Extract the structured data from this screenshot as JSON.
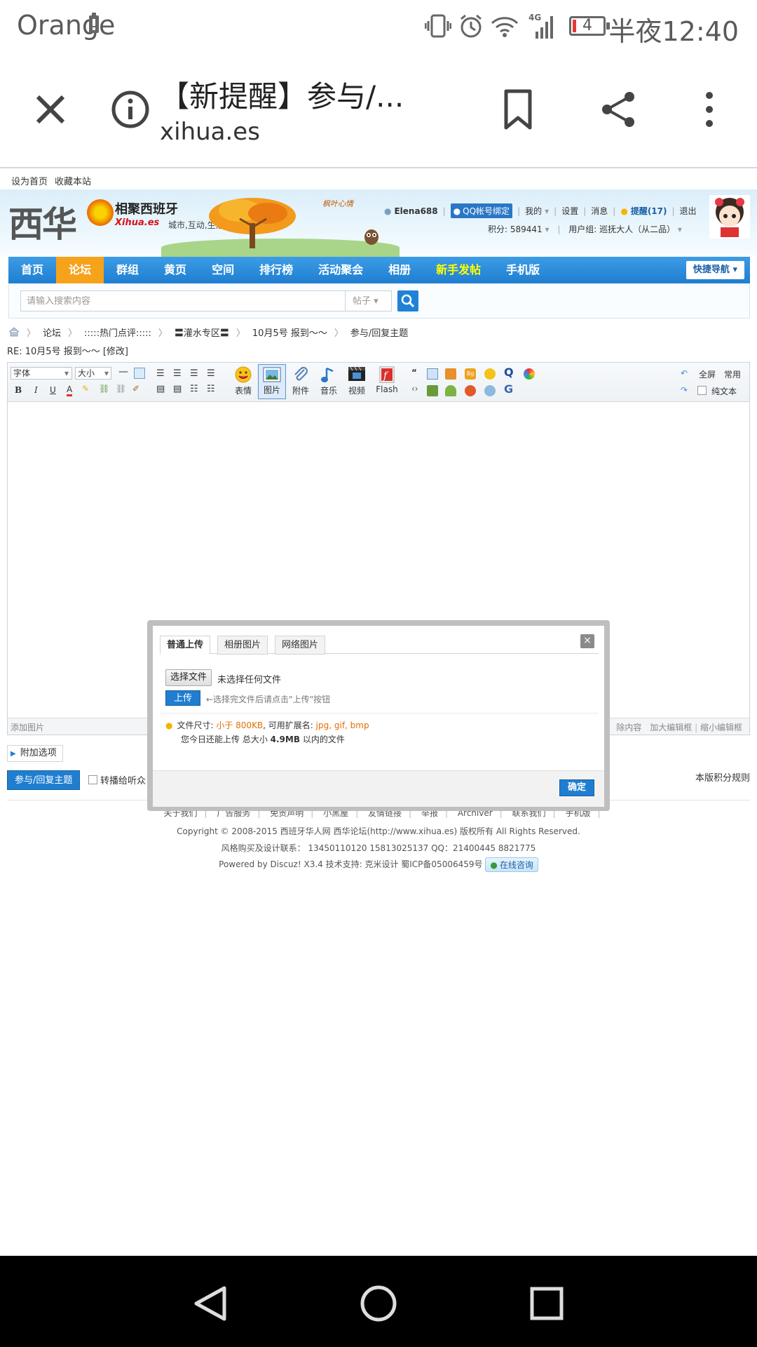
{
  "status_bar": {
    "carrier": "Orange",
    "battery_level": "4",
    "network": "4G",
    "time": "半夜12:40"
  },
  "browser": {
    "title": "【新提醒】参与/...",
    "url": "xihua.es"
  },
  "site": {
    "top_links": [
      "设为首页",
      "收藏本站"
    ],
    "logo": {
      "name": "西华",
      "slogan_cn": "相聚西班牙",
      "domain": "Xihua.es",
      "tagline": "城市,互动,生活",
      "banner_text": "枫叶心情"
    },
    "user": {
      "username": "Elena688",
      "qq_bind": "QQ帐号绑定",
      "my": "我的",
      "settings": "设置",
      "messages": "消息",
      "reminders": "提醒(17)",
      "logout": "退出",
      "points": "积分: 589441",
      "group": "用户组: 巡抚大人（从二品）"
    },
    "nav": {
      "items": [
        "首页",
        "论坛",
        "群组",
        "黄页",
        "空间",
        "排行榜",
        "活动聚会",
        "相册",
        "新手发帖",
        "手机版"
      ],
      "active_index": 1,
      "highlight_index": 8,
      "quick_nav": "快捷导航"
    },
    "search": {
      "placeholder": "请输入搜索内容",
      "type": "帖子"
    },
    "breadcrumb": [
      "论坛",
      ":::::热门点评:::::",
      "〓灌水专区〓",
      "10月5号 报到～～",
      "参与/回复主题"
    ],
    "post_title": "RE: 10月5号 报到～～ [修改]"
  },
  "editor": {
    "font_select": "字体",
    "size_select": "大小",
    "tools": [
      "表情",
      "图片",
      "附件",
      "音乐",
      "视频",
      "Flash"
    ],
    "right_tools": {
      "fullscreen": "全屏",
      "common": "常用",
      "plain_text": "纯文本"
    },
    "footer_left": "添加图片",
    "footer_right": [
      "除内容",
      "加大编辑框",
      "缩小编辑框"
    ]
  },
  "below_editor": {
    "extra_options": "附加选项",
    "submit": "参与/回复主题",
    "relay": "转播给听众",
    "rules": "本版积分规则"
  },
  "dialog": {
    "tabs": [
      "普通上传",
      "相册图片",
      "网络图片"
    ],
    "active_tab": 0,
    "close": "×",
    "choose_file": "选择文件",
    "no_file": "未选择任何文件",
    "upload": "上传",
    "upload_hint": "←选择完文件后请点击\"上传\"按钮",
    "size_label": "文件尺寸: ",
    "size_value": "小于 800KB",
    "ext_label": ", 可用扩展名: ",
    "ext_value": "jpg, gif, bmp",
    "quota_prefix": "您今日还能上传 总大小 ",
    "quota_value": "4.9MB",
    "quota_suffix": " 以内的文件",
    "ok": "确定"
  },
  "footer": {
    "links": [
      "关于我们",
      "广告服务",
      "免责声明",
      "小黑屋",
      "友情链接",
      "举报",
      "Archiver",
      "联系我们",
      "手机版"
    ],
    "copyright": "Copyright © 2008-2015 西班牙华人网 西华论坛(http://www.xihua.es) 版权所有 All Rights Reserved.",
    "contact": "风格购买及设计联系： 13450110120 15813025137 QQ：21400445 8821775",
    "powered": "Powered by Discuz! X3.4  技术支持: 克米设计 蜀ICP备05006459号",
    "consult": "在线咨询"
  }
}
